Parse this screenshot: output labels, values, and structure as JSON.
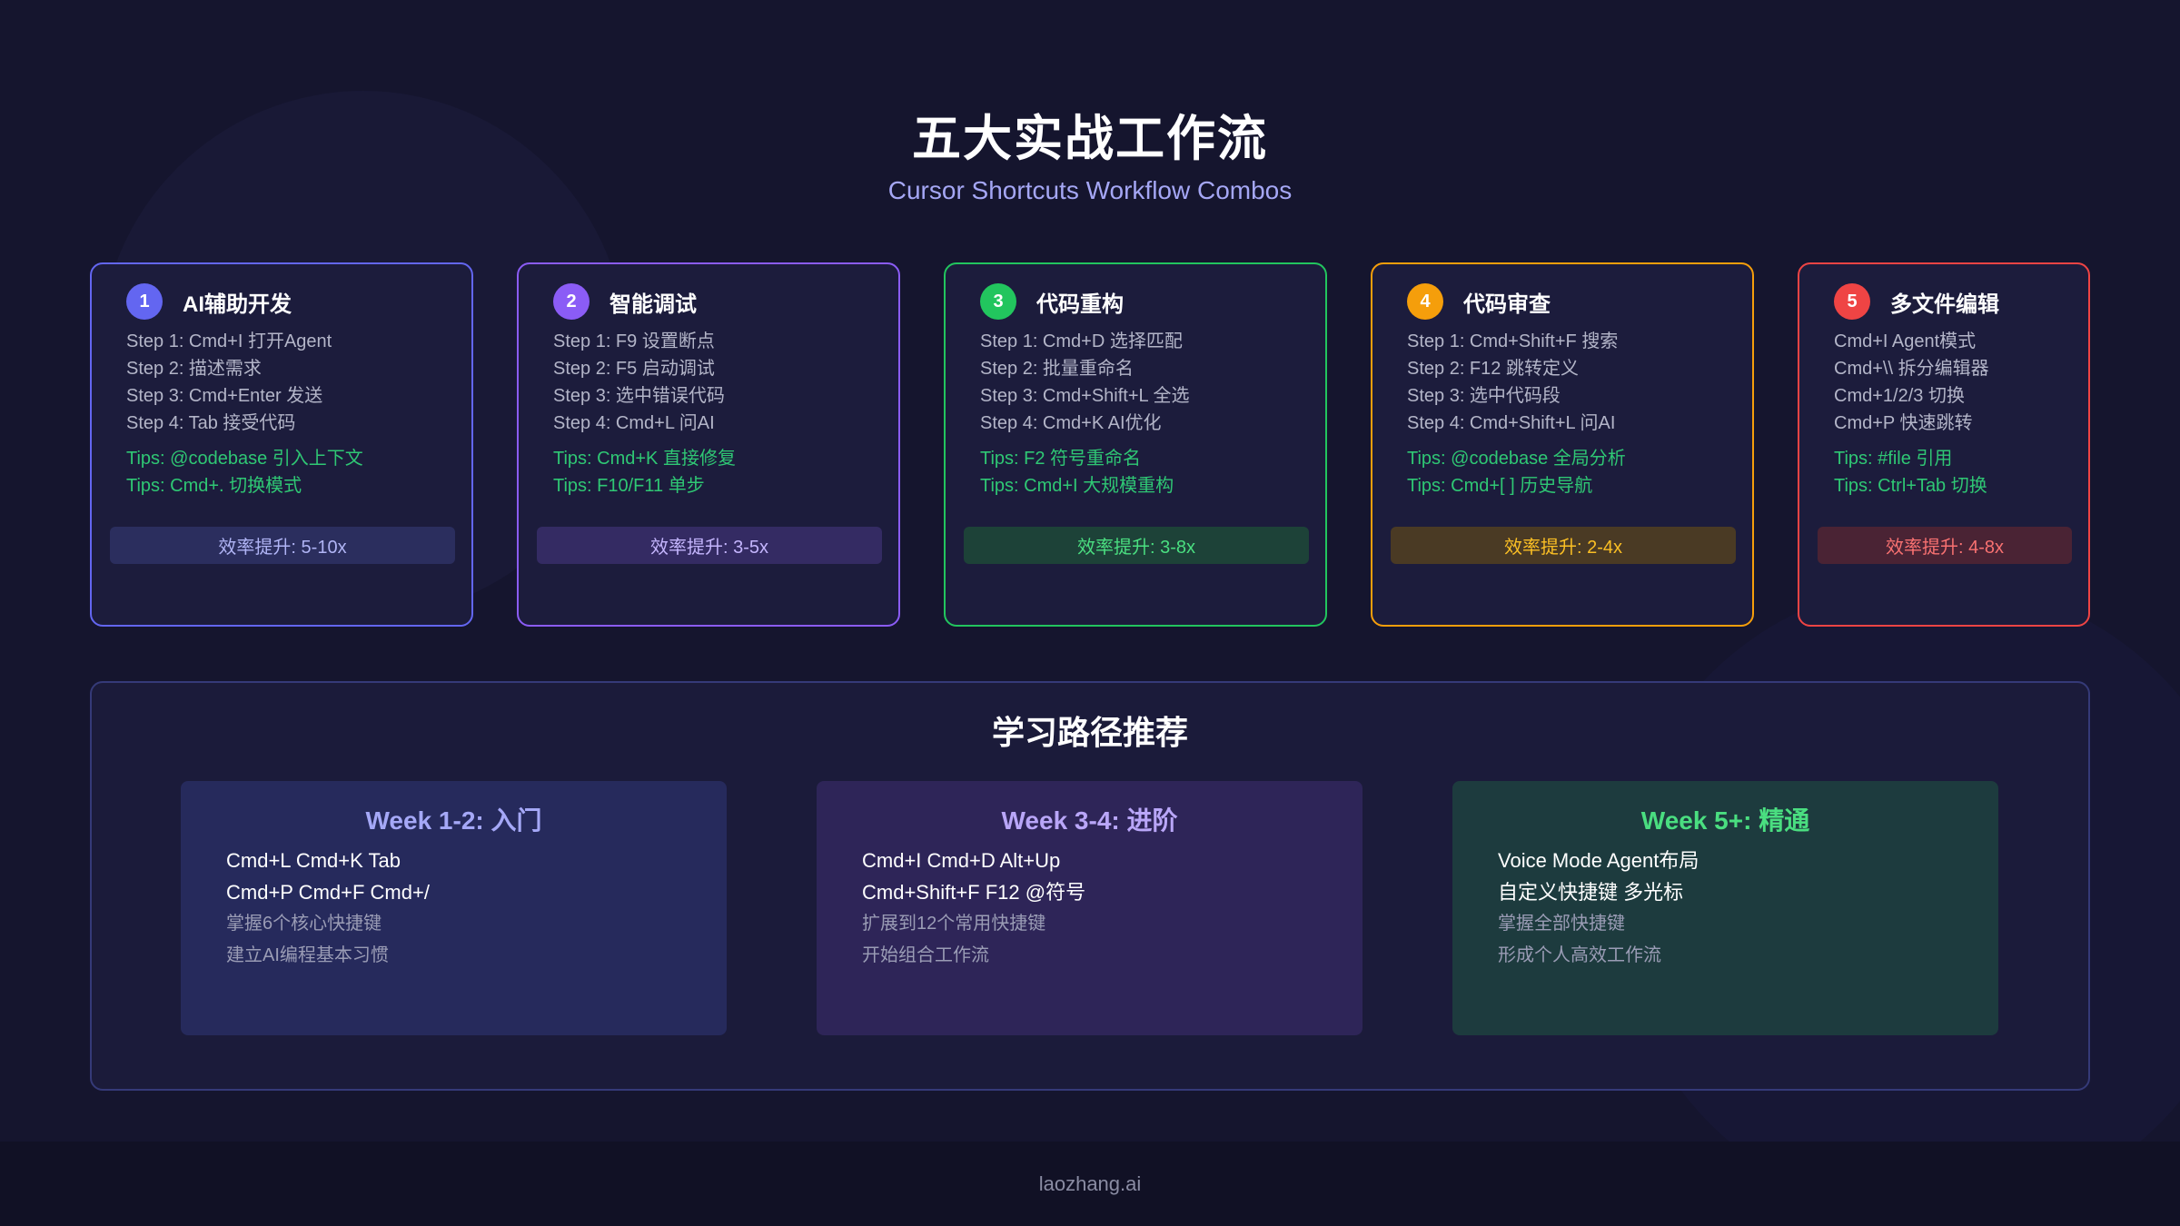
{
  "header": {
    "title": "五大实战工作流",
    "subtitle": "Cursor Shortcuts Workflow Combos"
  },
  "colors": {
    "blue": "#6366f1",
    "purple": "#8b5cf6",
    "green": "#22c55e",
    "orange": "#f59e0b",
    "red": "#ef4444"
  },
  "workflows": [
    {
      "number": "1",
      "title": "AI辅助开发",
      "steps": [
        "Step 1: Cmd+I 打开Agent",
        "Step 2: 描述需求",
        "Step 3: Cmd+Enter 发送",
        "Step 4: Tab 接受代码"
      ],
      "tips": [
        "Tips: @codebase 引入上下文",
        "Tips: Cmd+. 切换模式"
      ],
      "efficiency": "效率提升: 5-10x"
    },
    {
      "number": "2",
      "title": "智能调试",
      "steps": [
        "Step 1: F9 设置断点",
        "Step 2: F5 启动调试",
        "Step 3: 选中错误代码",
        "Step 4: Cmd+L 问AI"
      ],
      "tips": [
        "Tips: Cmd+K 直接修复",
        "Tips: F10/F11 单步"
      ],
      "efficiency": "效率提升: 3-5x"
    },
    {
      "number": "3",
      "title": "代码重构",
      "steps": [
        "Step 1: Cmd+D 选择匹配",
        "Step 2: 批量重命名",
        "Step 3: Cmd+Shift+L 全选",
        "Step 4: Cmd+K AI优化"
      ],
      "tips": [
        "Tips: F2 符号重命名",
        "Tips: Cmd+I 大规模重构"
      ],
      "efficiency": "效率提升: 3-8x"
    },
    {
      "number": "4",
      "title": "代码审查",
      "steps": [
        "Step 1: Cmd+Shift+F 搜索",
        "Step 2: F12 跳转定义",
        "Step 3: 选中代码段",
        "Step 4: Cmd+Shift+L 问AI"
      ],
      "tips": [
        "Tips: @codebase 全局分析",
        "Tips: Cmd+[ ] 历史导航"
      ],
      "efficiency": "效率提升: 2-4x"
    },
    {
      "number": "5",
      "title": "多文件编辑",
      "steps": [
        "Cmd+I Agent模式",
        "Cmd+\\\\ 拆分编辑器",
        "Cmd+1/2/3 切换",
        "Cmd+P 快速跳转"
      ],
      "tips": [
        "Tips: #file 引用",
        "Tips: Ctrl+Tab 切换"
      ],
      "efficiency": "效率提升: 4-8x"
    }
  ],
  "learning_path": {
    "title": "学习路径推荐",
    "weeks": [
      {
        "title": "Week 1-2: 入门",
        "shortcuts": [
          "Cmd+L Cmd+K Tab",
          "Cmd+P Cmd+F Cmd+/"
        ],
        "goals": [
          "掌握6个核心快捷键",
          "建立AI编程基本习惯"
        ]
      },
      {
        "title": "Week 3-4: 进阶",
        "shortcuts": [
          "Cmd+I Cmd+D Alt+Up",
          "Cmd+Shift+F F12 @符号"
        ],
        "goals": [
          "扩展到12个常用快捷键",
          "开始组合工作流"
        ]
      },
      {
        "title": "Week 5+: 精通",
        "shortcuts": [
          "Voice Mode Agent布局",
          "自定义快捷键 多光标"
        ],
        "goals": [
          "掌握全部快捷键",
          "形成个人高效工作流"
        ]
      }
    ]
  },
  "footer": {
    "text": "laozhang.ai"
  }
}
